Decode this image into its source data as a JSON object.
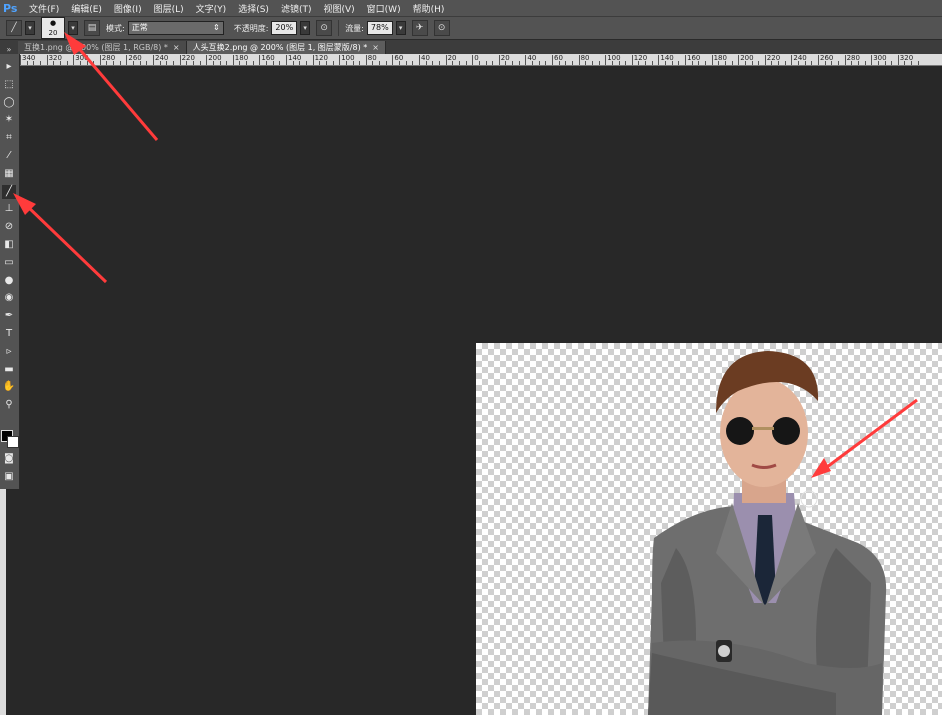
{
  "app": {
    "logo": "Ps"
  },
  "menu": [
    "文件(F)",
    "编辑(E)",
    "图像(I)",
    "图层(L)",
    "文字(Y)",
    "选择(S)",
    "滤镜(T)",
    "视图(V)",
    "窗口(W)",
    "帮助(H)"
  ],
  "options": {
    "brush_size": "20",
    "mode_label": "模式:",
    "mode_value": "正常",
    "opacity_label": "不透明度:",
    "opacity_value": "20%",
    "flow_label": "流量:",
    "flow_value": "78%"
  },
  "tabs": [
    {
      "label": "互换1.png @ 200% (图层 1, RGB/8) *",
      "active": false
    },
    {
      "label": "人头互换2.png @ 200% (图层 1, 图层蒙版/8) *",
      "active": true
    }
  ],
  "ruler_labels": [
    "340",
    "320",
    "300",
    "280",
    "260",
    "240",
    "220",
    "200",
    "180",
    "160",
    "140",
    "120",
    "100",
    "80",
    "60",
    "40",
    "20",
    "0",
    "20",
    "40",
    "60",
    "80",
    "100",
    "120",
    "140",
    "160",
    "180",
    "200",
    "220",
    "240",
    "260",
    "280",
    "300",
    "320"
  ],
  "tools": [
    {
      "name": "move-tool-icon",
      "glyph": "▸"
    },
    {
      "name": "marquee-tool-icon",
      "glyph": "⬚"
    },
    {
      "name": "lasso-tool-icon",
      "glyph": "◯"
    },
    {
      "name": "magic-wand-tool-icon",
      "glyph": "✶"
    },
    {
      "name": "crop-tool-icon",
      "glyph": "⌗"
    },
    {
      "name": "eyedropper-tool-icon",
      "glyph": "⁄"
    },
    {
      "name": "healing-tool-icon",
      "glyph": "▦"
    },
    {
      "name": "brush-tool-icon",
      "glyph": "╱"
    },
    {
      "name": "stamp-tool-icon",
      "glyph": "⊥"
    },
    {
      "name": "history-brush-tool-icon",
      "glyph": "⊘"
    },
    {
      "name": "eraser-tool-icon",
      "glyph": "◧"
    },
    {
      "name": "gradient-tool-icon",
      "glyph": "▭"
    },
    {
      "name": "blur-tool-icon",
      "glyph": "●"
    },
    {
      "name": "dodge-tool-icon",
      "glyph": "◉"
    },
    {
      "name": "pen-tool-icon",
      "glyph": "✒"
    },
    {
      "name": "type-tool-icon",
      "glyph": "T"
    },
    {
      "name": "path-select-tool-icon",
      "glyph": "▹"
    },
    {
      "name": "shape-tool-icon",
      "glyph": "▬"
    },
    {
      "name": "hand-tool-icon",
      "glyph": "✋"
    },
    {
      "name": "zoom-tool-icon",
      "glyph": "⚲"
    }
  ],
  "colors": {
    "ui_dark": "#282828",
    "panel": "#535353",
    "arrow": "#ff3b3b",
    "logo": "#4fa3ff"
  }
}
